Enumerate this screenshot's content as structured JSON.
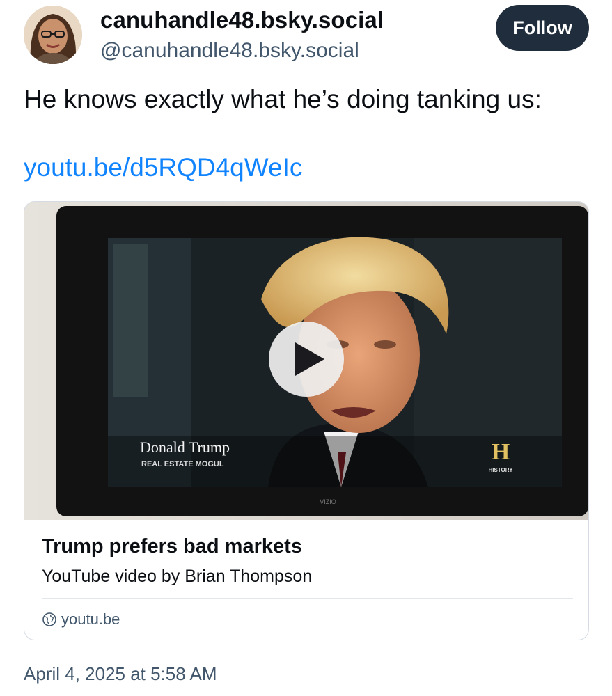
{
  "author": {
    "display_name": "canuhandle48.bsky.social",
    "handle": "@canuhandle48.bsky.social",
    "avatar": "avatar-photo"
  },
  "follow_button": {
    "label": "Follow"
  },
  "post": {
    "text": "He knows exactly what he’s doing tanking us:",
    "link": "youtu.be/d5RQD4qWeIc",
    "timestamp": "April 4, 2025 at 5:58 AM"
  },
  "embed": {
    "thumbnail": {
      "lower_third_name": "Donald Trump",
      "lower_third_title": "REAL ESTATE MOGUL",
      "channel_logo_letter": "H",
      "channel_logo_text": "HISTORY",
      "tv_brand": "VIZIO"
    },
    "play_icon": "play-icon",
    "title": "Trump prefers bad markets",
    "description": "YouTube video by Brian Thompson",
    "domain": "youtu.be",
    "domain_icon": "globe-icon"
  },
  "colors": {
    "link": "#1083fe",
    "follow_bg": "#1f2d3d",
    "secondary_text": "#42576c",
    "border": "#d4dbe2"
  }
}
